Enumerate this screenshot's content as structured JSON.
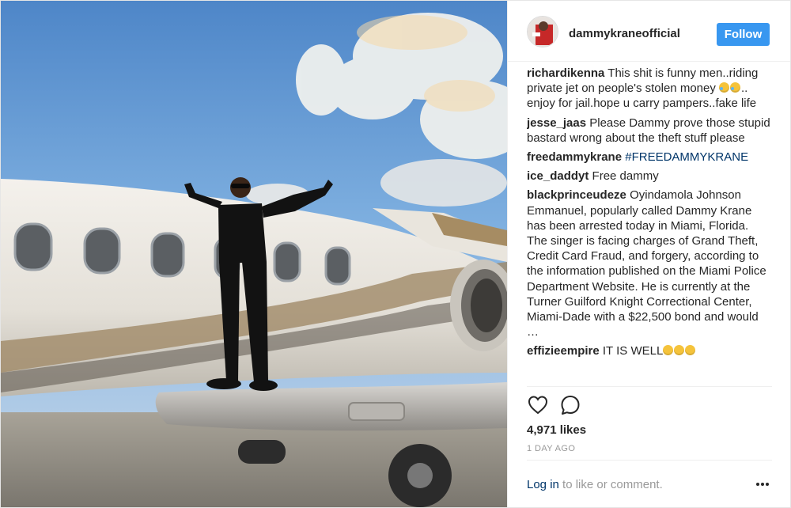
{
  "post": {
    "username": "dammykraneofficial",
    "follow_label": "Follow",
    "likes": "4,971 likes",
    "time": "1 DAY AGO",
    "login_link": "Log in",
    "login_rest": " to like or comment."
  },
  "comments": [
    {
      "user": "richardikenna",
      "text": "This shit is funny men..riding private jet on people's stolen money ",
      "emoji_after": 2,
      "text2": ".. enjoy for jail.hope u carry pampers..fake life"
    },
    {
      "user": "jesse_jaas",
      "text": "Please Dammy prove those stupid bastard wrong about the theft stuff please"
    },
    {
      "user": "freedammykrane",
      "hashtag": "#FREEDAMMYKRANE"
    },
    {
      "user": "ice_daddyt",
      "text": "Free dammy"
    },
    {
      "user": "blackprinceudeze",
      "text": "Oyindamola Johnson Emmanuel, popularly called Dammy Krane has been arrested today in Miami, Florida. The singer is facing charges of Grand Theft, Credit Card Fraud, and forgery, according to the information published on the Miami Police Department Website. He is currently at the Turner Guilford Knight Correctional Center, Miami-Dade with a $22,500 bond and would …"
    },
    {
      "user": "effizieempire",
      "text": "IT IS WELL",
      "emoji_after": 3
    }
  ],
  "icons": {
    "like": "heart-outline-icon",
    "comment": "speech-bubble-icon",
    "more": "ellipsis-icon"
  },
  "colors": {
    "follow_bg": "#3897f0",
    "link": "#003569",
    "muted": "#999999"
  }
}
